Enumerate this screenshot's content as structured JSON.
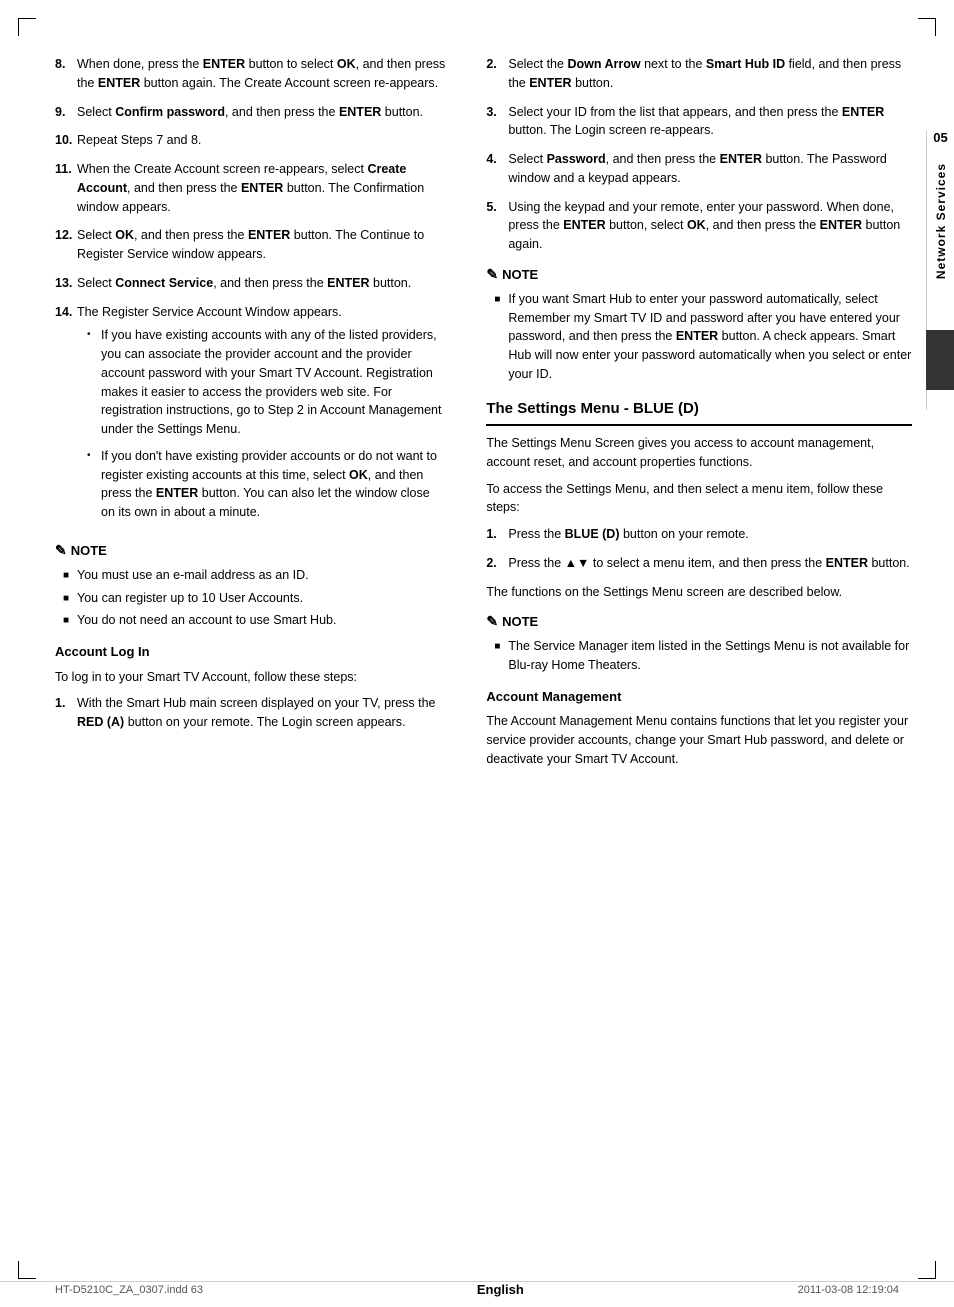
{
  "page": {
    "title": "Network Services",
    "chapter": "05",
    "language": "English",
    "footer_left": "HT-D5210C_ZA_0307.indd   63",
    "footer_right": "2011-03-08     12:19:04"
  },
  "left_column": {
    "items": [
      {
        "number": "8.",
        "text": "When done, press the ",
        "bold_parts": [
          [
            "ENTER",
            "button to select "
          ],
          [
            "OK",
            ", and then press the "
          ],
          [
            "ENTER",
            " button again. The Create Account screen re-appears."
          ]
        ]
      },
      {
        "number": "9.",
        "text": "Select ",
        "bold_parts": [
          [
            "Confirm password",
            ", and then press the "
          ],
          [
            "ENTER",
            " button."
          ]
        ]
      },
      {
        "number": "10.",
        "text": "Repeat Steps 7 and 8."
      },
      {
        "number": "11.",
        "text": "When the Create Account screen re-appears, select ",
        "bold_parts": [
          [
            "Create Account",
            ", and then press the "
          ],
          [
            "ENTER",
            " button. The Confirmation window appears."
          ]
        ]
      },
      {
        "number": "12.",
        "text": "Select ",
        "bold_parts": [
          [
            "OK",
            ", and then press the "
          ],
          [
            "ENTER",
            " button. The Continue to Register Service window appears."
          ]
        ]
      },
      {
        "number": "13.",
        "text": "Select ",
        "bold_parts": [
          [
            "Connect Service",
            ", and then press the "
          ],
          [
            "ENTER",
            " button."
          ]
        ]
      },
      {
        "number": "14.",
        "text": "The Register Service Account Window appears."
      }
    ],
    "bullet_items": [
      "If you have existing accounts with any of the listed providers, you can associate the provider account and the provider account password with your Smart TV Account. Registration makes it easier to access the providers web site. For registration instructions, go to Step 2 in Account Management under the Settings Menu.",
      "If you don't have existing provider accounts or do not want to register existing accounts at this time, select OK, and then press the ENTER button. You can also let the window close on its own in about a minute."
    ],
    "note_header": "NOTE",
    "note_items": [
      "You must use an e-mail address as an ID.",
      "You can register up to 10 User Accounts.",
      "You do not need an account to use Smart Hub."
    ],
    "subsection_account_log_in": "Account Log In",
    "account_log_in_intro": "To log in to your Smart TV Account, follow these steps:",
    "login_steps": [
      {
        "number": "1.",
        "text": "With the Smart Hub main screen displayed on your TV, press the ",
        "bold": "RED (A)",
        "text2": " button on your remote. The Login screen appears."
      }
    ]
  },
  "right_column": {
    "steps": [
      {
        "number": "2.",
        "text": "Select the ",
        "bold": "Down Arrow",
        "text2": " next to the ",
        "bold2": "Smart Hub ID",
        "text3": " field, and then press the ",
        "bold3": "ENTER",
        "text4": " button."
      },
      {
        "number": "3.",
        "text": "Select your ID from the list that appears, and then press the ",
        "bold": "ENTER",
        "text2": " button. The Login screen re-appears."
      },
      {
        "number": "4.",
        "text": "Select ",
        "bold": "Password",
        "text2": ", and then press the ",
        "bold2": "ENTER",
        "text3": " button. The Password window and a keypad appears."
      },
      {
        "number": "5.",
        "text": "Using the keypad and your remote, enter your password. When done, press the ",
        "bold": "ENTER",
        "text2": " button, select ",
        "bold2": "OK",
        "text3": ", and then press the ",
        "bold3": "ENTER",
        "text4": " button again."
      }
    ],
    "note_header": "NOTE",
    "note_item": "If you want Smart Hub to enter your password automatically, select Remember my Smart TV ID and password after you have entered your password, and then press the ENTER button. A check appears. Smart Hub will now enter your password automatically when you select or enter your ID.",
    "note_enter_bold": "ENTER",
    "section_title": "The Settings Menu - BLUE (D)",
    "section_intro": "The Settings Menu Screen gives you access to account management, account reset, and account properties functions.",
    "section_intro2": "To access the Settings Menu, and then select a menu item, follow these steps:",
    "settings_steps": [
      {
        "number": "1.",
        "text": "Press the ",
        "bold": "BLUE (D)",
        "text2": " button on your remote."
      },
      {
        "number": "2.",
        "text": "Press the ▲▼ to select a menu item, and then press the ",
        "bold": "ENTER",
        "text2": " button."
      }
    ],
    "settings_outro": "The functions on the Settings Menu screen are described below.",
    "settings_note_header": "NOTE",
    "settings_note_item": "The Service Manager item listed in the Settings Menu is not available for Blu-ray Home Theaters.",
    "account_mgmt_heading": "Account Management",
    "account_mgmt_text": "The Account Management Menu contains functions that let you register your service provider accounts, change your Smart Hub password, and delete or deactivate your Smart TV Account."
  }
}
